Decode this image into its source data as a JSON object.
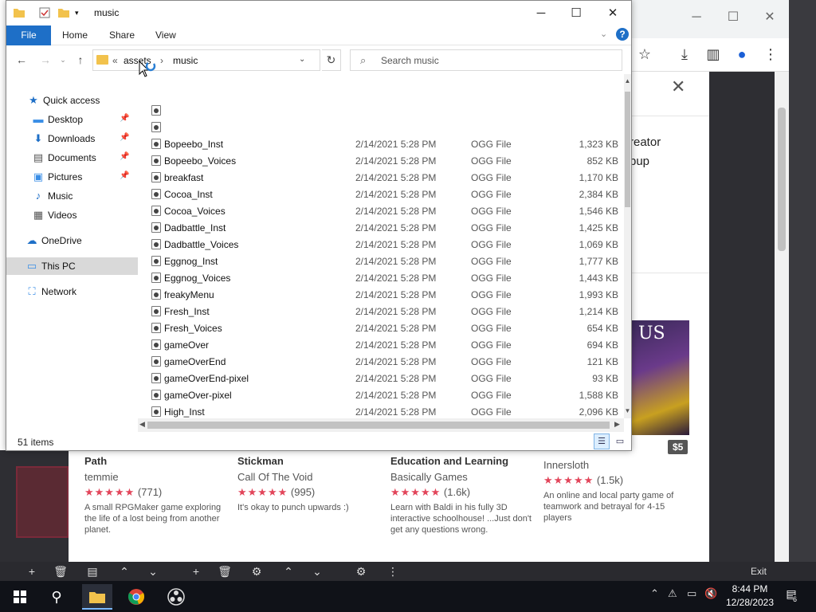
{
  "explorer": {
    "title": "music",
    "ribbon": {
      "file": "File",
      "home": "Home",
      "share": "Share",
      "view": "View",
      "help": "?"
    },
    "address": {
      "prefix": "«",
      "parent": "assets",
      "sep": "›",
      "current": "music"
    },
    "search_placeholder": "Search music",
    "nav": [
      {
        "label": "Quick access",
        "icon": "star-icon",
        "pinned": false
      },
      {
        "label": "Desktop",
        "icon": "desktop-icon",
        "pinned": true
      },
      {
        "label": "Downloads",
        "icon": "download-icon",
        "pinned": true
      },
      {
        "label": "Documents",
        "icon": "document-icon",
        "pinned": true
      },
      {
        "label": "Pictures",
        "icon": "pictures-icon",
        "pinned": true
      },
      {
        "label": "Music",
        "icon": "music-icon",
        "pinned": false
      },
      {
        "label": "Videos",
        "icon": "videos-icon",
        "pinned": false
      },
      {
        "label": "OneDrive",
        "icon": "cloud-icon",
        "pinned": false
      },
      {
        "label": "This PC",
        "icon": "pc-icon",
        "pinned": false,
        "selected": true
      },
      {
        "label": "Network",
        "icon": "network-icon",
        "pinned": false
      }
    ],
    "files": [
      {
        "name": "",
        "date": "",
        "type": "",
        "size": ""
      },
      {
        "name": "",
        "date": "",
        "type": "",
        "size": ""
      },
      {
        "name": "Bopeebo_Inst",
        "date": "2/14/2021 5:28 PM",
        "type": "OGG File",
        "size": "1,323 KB"
      },
      {
        "name": "Bopeebo_Voices",
        "date": "2/14/2021 5:28 PM",
        "type": "OGG File",
        "size": "852 KB"
      },
      {
        "name": "breakfast",
        "date": "2/14/2021 5:28 PM",
        "type": "OGG File",
        "size": "1,170 KB"
      },
      {
        "name": "Cocoa_Inst",
        "date": "2/14/2021 5:28 PM",
        "type": "OGG File",
        "size": "2,384 KB"
      },
      {
        "name": "Cocoa_Voices",
        "date": "2/14/2021 5:28 PM",
        "type": "OGG File",
        "size": "1,546 KB"
      },
      {
        "name": "Dadbattle_Inst",
        "date": "2/14/2021 5:28 PM",
        "type": "OGG File",
        "size": "1,425 KB"
      },
      {
        "name": "Dadbattle_Voices",
        "date": "2/14/2021 5:28 PM",
        "type": "OGG File",
        "size": "1,069 KB"
      },
      {
        "name": "Eggnog_Inst",
        "date": "2/14/2021 5:28 PM",
        "type": "OGG File",
        "size": "1,777 KB"
      },
      {
        "name": "Eggnog_Voices",
        "date": "2/14/2021 5:28 PM",
        "type": "OGG File",
        "size": "1,443 KB"
      },
      {
        "name": "freakyMenu",
        "date": "2/14/2021 5:28 PM",
        "type": "OGG File",
        "size": "1,993 KB"
      },
      {
        "name": "Fresh_Inst",
        "date": "2/14/2021 5:28 PM",
        "type": "OGG File",
        "size": "1,214 KB"
      },
      {
        "name": "Fresh_Voices",
        "date": "2/14/2021 5:28 PM",
        "type": "OGG File",
        "size": "654 KB"
      },
      {
        "name": "gameOver",
        "date": "2/14/2021 5:28 PM",
        "type": "OGG File",
        "size": "694 KB"
      },
      {
        "name": "gameOverEnd",
        "date": "2/14/2021 5:28 PM",
        "type": "OGG File",
        "size": "121 KB"
      },
      {
        "name": "gameOverEnd-pixel",
        "date": "2/14/2021 5:28 PM",
        "type": "OGG File",
        "size": "93 KB"
      },
      {
        "name": "gameOver-pixel",
        "date": "2/14/2021 5:28 PM",
        "type": "OGG File",
        "size": "1,588 KB"
      },
      {
        "name": "High_Inst",
        "date": "2/14/2021 5:28 PM",
        "type": "OGG File",
        "size": "2,096 KB"
      }
    ],
    "status": "51 items"
  },
  "browser": {
    "partial_text_1": "reator",
    "partial_text_2": "pup",
    "amongus_text": "US",
    "price": "$5",
    "cards": [
      {
        "title": "Path",
        "author": "temmie",
        "stars": "★★★★★",
        "count": "(771)",
        "desc": "A small RPGMaker game exploring the life of a lost being from another planet."
      },
      {
        "title": "Stickman",
        "author": "Call Of The Void",
        "stars": "★★★★★",
        "count": "(995)",
        "desc": "It's okay to punch upwards :)"
      },
      {
        "title": "Education and Learning",
        "author": "Basically Games",
        "stars": "★★★★★",
        "count": "(1.6k)",
        "desc": "Learn with Baldi in his fully 3D interactive schoolhouse! ...Just don't get any questions wrong."
      },
      {
        "title": "",
        "author": "Innersloth",
        "stars": "★★★★★",
        "count": "(1.5k)",
        "desc": "An online and local party game of teamwork and betrayal for 4-15 players"
      }
    ],
    "exit_label": "Exit"
  },
  "taskbar": {
    "time": "8:44 PM",
    "date": "12/28/2023",
    "notifications": "6"
  },
  "colors": {
    "accent": "#1e6fc7",
    "star": "#e2455a",
    "folder": "#f2c24c"
  }
}
